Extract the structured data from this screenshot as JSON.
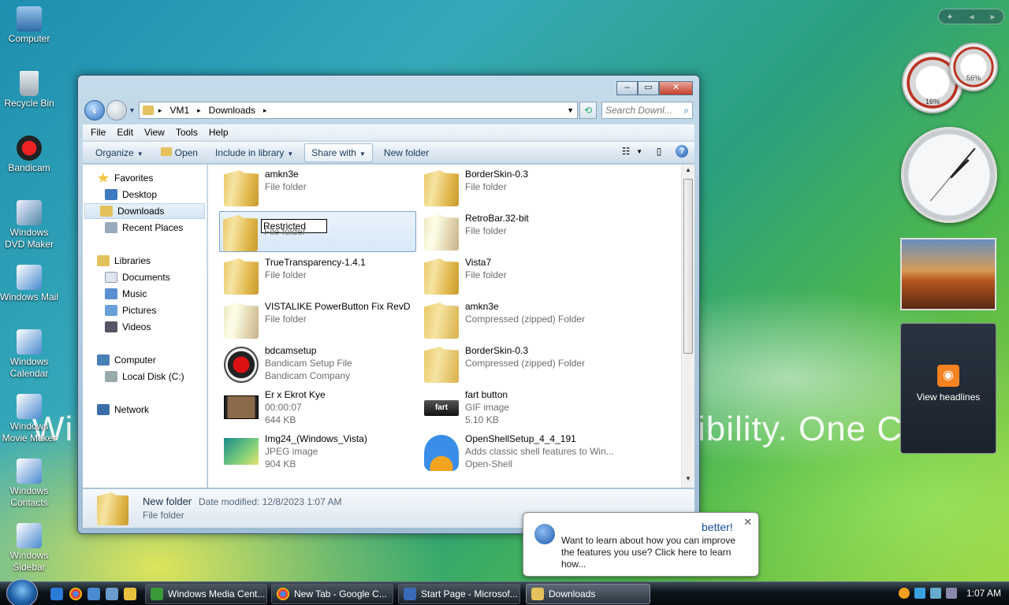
{
  "desktop": {
    "watermark_left": "Wi",
    "watermark_right": "ibility. One C",
    "icons": [
      {
        "label": "Computer"
      },
      {
        "label": "Recycle Bin"
      },
      {
        "label": "Bandicam"
      },
      {
        "label": "Windows DVD Maker"
      },
      {
        "label": "Windows Mail"
      },
      {
        "label": "Windows Calendar"
      },
      {
        "label": "Windows Movie Maker"
      },
      {
        "label": "Windows Contacts"
      },
      {
        "label": "Windows Sidebar"
      }
    ]
  },
  "explorer": {
    "breadcrumb": [
      "VM1",
      "Downloads"
    ],
    "search_placeholder": "Search Downl...",
    "menu": [
      "File",
      "Edit",
      "View",
      "Tools",
      "Help"
    ],
    "commands": {
      "organize": "Organize",
      "open": "Open",
      "include": "Include in library",
      "share": "Share with",
      "new_folder": "New folder"
    },
    "nav": {
      "favorites": "Favorites",
      "desktop": "Desktop",
      "downloads": "Downloads",
      "recent": "Recent Places",
      "libraries": "Libraries",
      "documents": "Documents",
      "music": "Music",
      "pictures": "Pictures",
      "videos": "Videos",
      "computer": "Computer",
      "local_disk": "Local Disk (C:)",
      "network": "Network"
    },
    "files": [
      {
        "name": "amkn3e",
        "l2": "File folder",
        "l3": ""
      },
      {
        "name": "BorderSkin-0.3",
        "l2": "File folder",
        "l3": ""
      },
      {
        "name": "Restricted",
        "l2": "File folder",
        "l3": ""
      },
      {
        "name": "RetroBar.32-bit",
        "l2": "File folder",
        "l3": ""
      },
      {
        "name": "TrueTransparency-1.4.1",
        "l2": "File folder",
        "l3": ""
      },
      {
        "name": "Vista7",
        "l2": "File folder",
        "l3": ""
      },
      {
        "name": "VISTALIKE PowerButton Fix RevD",
        "l2": "File folder",
        "l3": ""
      },
      {
        "name": "amkn3e",
        "l2": "Compressed (zipped) Folder",
        "l3": ""
      },
      {
        "name": "bdcamsetup",
        "l2": "Bandicam Setup File",
        "l3": "Bandicam Company"
      },
      {
        "name": "BorderSkin-0.3",
        "l2": "Compressed (zipped) Folder",
        "l3": ""
      },
      {
        "name": "Er x Ekrot Kye",
        "l2": "00:00:07",
        "l3": "644 KB"
      },
      {
        "name": "fart button",
        "l2": "GIF image",
        "l3": "5.10 KB"
      },
      {
        "name": "Img24_(Windows_Vista)",
        "l2": "JPEG image",
        "l3": "904 KB"
      },
      {
        "name": "OpenShellSetup_4_4_191",
        "l2": "Adds classic shell features to Win...",
        "l3": "Open-Shell"
      }
    ],
    "fart_thumb_text": "fart",
    "details": {
      "name": "New folder",
      "date_modified": "Date modified: 12/8/2023 1:07 AM",
      "type": "File folder"
    }
  },
  "gadgets": {
    "cpu_percent": "16%",
    "mem_percent": "56%",
    "feed_label": "View headlines"
  },
  "balloon": {
    "title_fragment": "better!",
    "text": "Want to learn about how you can improve the features you use? Click here to learn how..."
  },
  "taskbar": {
    "buttons": [
      "Windows Media Cent...",
      "New Tab - Google C...",
      "Start Page - Microsof...",
      "Downloads"
    ],
    "time": "1:07 AM"
  },
  "colors": {
    "accent": "#1a4d9c",
    "selection": "#d8e8f7",
    "taskbar": "#0d141a"
  }
}
